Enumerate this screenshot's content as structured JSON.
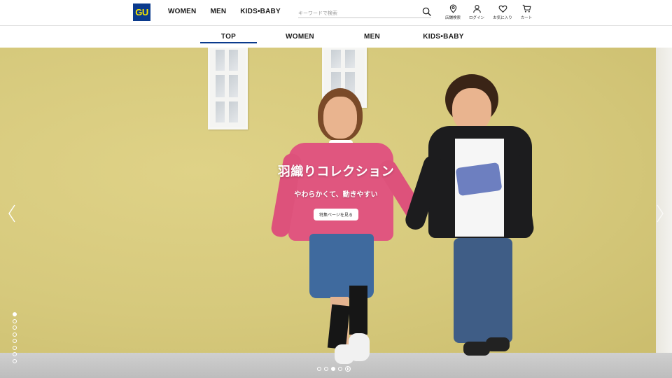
{
  "brand": {
    "logo_text": "GU",
    "logo_bg": "#0a3a8c",
    "logo_fg": "#f7e600"
  },
  "header": {
    "nav": [
      "WOMEN",
      "MEN",
      "KIDS•BABY"
    ],
    "search": {
      "placeholder": "キーワードで検索",
      "value": "",
      "icon": "search-icon"
    },
    "utilities": [
      {
        "label": "店舗検索",
        "icon": "location-pin-icon"
      },
      {
        "label": "ログイン",
        "icon": "user-icon"
      },
      {
        "label": "お気に入り",
        "icon": "heart-icon"
      },
      {
        "label": "カート",
        "icon": "cart-icon"
      }
    ]
  },
  "tabs": [
    {
      "label": "TOP",
      "active": true
    },
    {
      "label": "WOMEN",
      "active": false
    },
    {
      "label": "MEN",
      "active": false
    },
    {
      "label": "KIDS•BABY",
      "active": false
    }
  ],
  "accent_color": "#0a3a8c",
  "hero": {
    "title": "羽織りコレクション",
    "subtitle": "やわらかくて、動きやすい",
    "button_label": "特集ページを見る",
    "vertical_slide_count": 8,
    "vertical_active_index": 0,
    "carousel_slide_count": 4,
    "carousel_active_index": 2
  }
}
